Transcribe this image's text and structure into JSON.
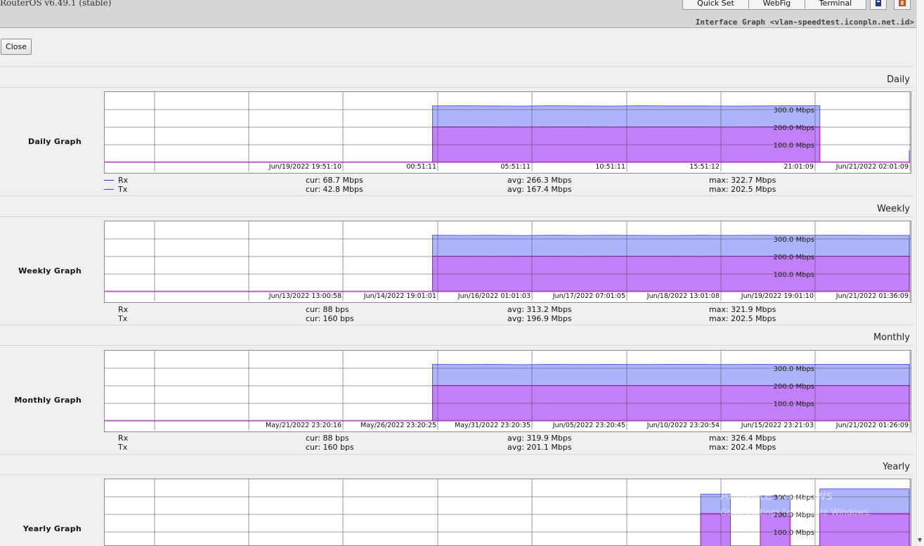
{
  "header": {
    "version": "RouterOS v6.49.1 (stable)",
    "buttons": [
      "Quick Set",
      "WebFig",
      "Terminal"
    ],
    "window_title": "Interface Graph <vlan-speedtest.iconpln.net.id>"
  },
  "close_label": "Close",
  "sections": [
    {
      "title": "Daily",
      "graph_label": "Daily Graph",
      "x_labels": [
        "Jun/19/2022 19:51:10",
        "00:51:11",
        "05:51:11",
        "10:51:11",
        "15:51:12",
        "21:01:09",
        "Jun/21/2022 02:01:09"
      ],
      "y_labels": [
        "300.0 Mbps",
        "200.0 Mbps",
        "100.0 Mbps"
      ],
      "rx": {
        "name": "Rx",
        "cur": "cur: 68.7 Mbps",
        "avg": "avg: 266.3 Mbps",
        "max": "max: 322.7 Mbps"
      },
      "tx": {
        "name": "Tx",
        "cur": "cur: 42.8 Mbps",
        "avg": "avg: 167.4 Mbps",
        "max": "max: 202.5 Mbps"
      }
    },
    {
      "title": "Weekly",
      "graph_label": "Weekly Graph",
      "x_labels": [
        "Jun/13/2022 13:00:58",
        "Jun/14/2022 19:01:01",
        "Jun/16/2022 01:01:03",
        "Jun/17/2022 07:01:05",
        "Jun/18/2022 13:01:08",
        "Jun/19/2022 19:01:10",
        "Jun/21/2022 01:36:09"
      ],
      "y_labels": [
        "300.0 Mbps",
        "200.0 Mbps",
        "100.0 Mbps"
      ],
      "rx": {
        "name": "Rx",
        "cur": "cur: 88 bps",
        "avg": "avg: 313.2 Mbps",
        "max": "max: 321.9 Mbps"
      },
      "tx": {
        "name": "Tx",
        "cur": "cur: 160 bps",
        "avg": "avg: 196.9 Mbps",
        "max": "max: 202.5 Mbps"
      }
    },
    {
      "title": "Monthly",
      "graph_label": "Monthly Graph",
      "x_labels": [
        "May/21/2022 23:20:16",
        "May/26/2022 23:20:25",
        "May/31/2022 23:20:35",
        "Jun/05/2022 23:20:45",
        "Jun/10/2022 23:20:54",
        "Jun/15/2022 23:21:03",
        "Jun/21/2022 01:26:09"
      ],
      "y_labels": [
        "300.0 Mbps",
        "200.0 Mbps",
        "100.0 Mbps"
      ],
      "rx": {
        "name": "Rx",
        "cur": "cur: 88 bps",
        "avg": "avg: 319.9 Mbps",
        "max": "max: 326.4 Mbps"
      },
      "tx": {
        "name": "Tx",
        "cur": "cur: 160 bps",
        "avg": "avg: 201.1 Mbps",
        "max": "max: 202.4 Mbps"
      }
    },
    {
      "title": "Yearly",
      "graph_label": "Yearly Graph",
      "y_labels": [
        "300.0 Mbps",
        "200.0 Mbps",
        "100.0 Mbps"
      ]
    }
  ],
  "watermark": {
    "line1": "Activate Windows",
    "line2": "Go to Settings to activate Windows."
  },
  "colors": {
    "rx": "#aab0fb",
    "rx_line": "#5a5ae6",
    "tx": "#c27cf8",
    "tx_line": "#b012c8",
    "background": "#f0f0f0"
  },
  "chart_data": [
    {
      "type": "area",
      "title": "Daily",
      "ylabel": "",
      "ylim": [
        0,
        400
      ],
      "y_ticks": [
        100,
        200,
        300
      ],
      "unit": "Mbps",
      "x": [
        0,
        1,
        2,
        3,
        4,
        5,
        6,
        7,
        8,
        9,
        10,
        11,
        12,
        13,
        14,
        15,
        16,
        17,
        18,
        19,
        20,
        21,
        22,
        23,
        24,
        25,
        26,
        27
      ],
      "series": [
        {
          "name": "Rx",
          "values": [
            0,
            0,
            0,
            0,
            0,
            0,
            0,
            0,
            0,
            0,
            0,
            321,
            322,
            321,
            320,
            322,
            321,
            320,
            322,
            321,
            321,
            320,
            321,
            322,
            0,
            0,
            0,
            68.7
          ]
        },
        {
          "name": "Tx",
          "values": [
            0,
            0,
            0,
            0,
            0,
            0,
            0,
            0,
            0,
            0,
            0,
            202,
            202,
            202,
            201,
            202,
            202,
            201,
            202,
            202,
            202,
            201,
            202,
            202,
            0,
            0,
            0,
            42.8
          ]
        }
      ]
    },
    {
      "type": "area",
      "title": "Weekly",
      "ylabel": "",
      "ylim": [
        0,
        400
      ],
      "y_ticks": [
        100,
        200,
        300
      ],
      "unit": "Mbps",
      "x": [
        0,
        1,
        2,
        3,
        4,
        5,
        6,
        7,
        8,
        9,
        10,
        11,
        12,
        13,
        14,
        15,
        16,
        17,
        18,
        19,
        20,
        21,
        22,
        23,
        24,
        25,
        26,
        27
      ],
      "series": [
        {
          "name": "Rx",
          "values": [
            0,
            0,
            0,
            0,
            0,
            0,
            0,
            0,
            0,
            0,
            0,
            321,
            320,
            321,
            319,
            321,
            320,
            321,
            320,
            319,
            321,
            320,
            321,
            320,
            321,
            321,
            320,
            0
          ]
        },
        {
          "name": "Tx",
          "values": [
            0,
            0,
            0,
            0,
            0,
            0,
            0,
            0,
            0,
            0,
            0,
            202,
            202,
            201,
            202,
            202,
            201,
            202,
            202,
            202,
            201,
            202,
            202,
            202,
            202,
            202,
            202,
            0
          ]
        }
      ]
    },
    {
      "type": "area",
      "title": "Monthly",
      "ylabel": "",
      "ylim": [
        0,
        400
      ],
      "y_ticks": [
        100,
        200,
        300
      ],
      "unit": "Mbps",
      "x": [
        0,
        1,
        2,
        3,
        4,
        5,
        6,
        7,
        8,
        9,
        10,
        11,
        12,
        13,
        14,
        15,
        16,
        17,
        18,
        19,
        20,
        21,
        22,
        23,
        24,
        25,
        26,
        27
      ],
      "series": [
        {
          "name": "Rx",
          "values": [
            0,
            0,
            0,
            0,
            0,
            0,
            0,
            0,
            0,
            0,
            0,
            322,
            321,
            322,
            320,
            322,
            321,
            322,
            321,
            322,
            322,
            321,
            322,
            321,
            322,
            322,
            322,
            0
          ]
        },
        {
          "name": "Tx",
          "values": [
            0,
            0,
            0,
            0,
            0,
            0,
            0,
            0,
            0,
            0,
            0,
            202,
            202,
            202,
            202,
            202,
            202,
            202,
            202,
            202,
            202,
            202,
            202,
            202,
            202,
            202,
            202,
            0
          ]
        }
      ]
    },
    {
      "type": "area",
      "title": "Yearly",
      "ylabel": "",
      "ylim": [
        0,
        400
      ],
      "y_ticks": [
        100,
        200,
        300
      ],
      "unit": "Mbps",
      "x": [
        0,
        1,
        2,
        3,
        4,
        5,
        6,
        7,
        8,
        9,
        10,
        11,
        12,
        13,
        14,
        15,
        16,
        17,
        18,
        19,
        20,
        21,
        22,
        23,
        24,
        25,
        26,
        27
      ],
      "series": [
        {
          "name": "Rx",
          "values": [
            0,
            0,
            0,
            0,
            0,
            0,
            0,
            0,
            0,
            0,
            0,
            0,
            0,
            0,
            0,
            0,
            0,
            0,
            0,
            0,
            315,
            0,
            305,
            0,
            345,
            345,
            345,
            345
          ]
        },
        {
          "name": "Tx",
          "values": [
            0,
            0,
            0,
            0,
            0,
            0,
            0,
            0,
            0,
            0,
            0,
            0,
            0,
            0,
            0,
            0,
            0,
            0,
            0,
            0,
            205,
            0,
            205,
            0,
            205,
            205,
            205,
            205
          ]
        }
      ]
    }
  ]
}
